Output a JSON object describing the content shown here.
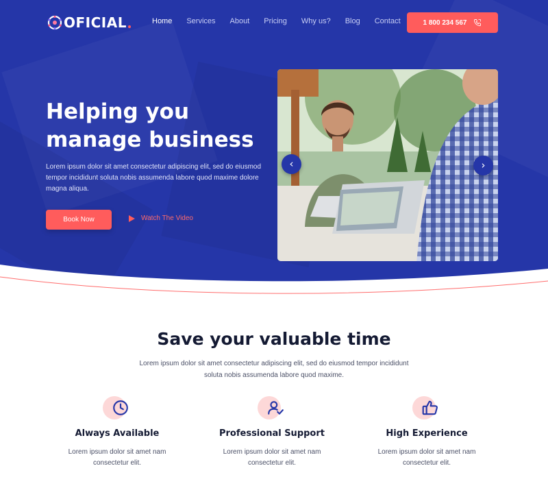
{
  "brand": {
    "logo_text": "OFICIAL"
  },
  "nav": {
    "items": [
      {
        "label": "Home",
        "active": true
      },
      {
        "label": "Services"
      },
      {
        "label": "About"
      },
      {
        "label": "Pricing"
      },
      {
        "label": "Why us?"
      },
      {
        "label": "Blog"
      },
      {
        "label": "Contact"
      }
    ],
    "phone_label": "1 800 234 567",
    "phone_icon": "phone-icon"
  },
  "hero": {
    "title_line1": "Helping you",
    "title_line2": "manage business",
    "description": "Lorem ipsum dolor sit amet consectetur adipiscing elit, sed do eiusmod tempor incididunt soluta nobis assumenda labore quod maxime dolore magna aliqua.",
    "book_label": "Book Now",
    "watch_label": "Watch The Video",
    "slider_prev_icon": "chevron-left-icon",
    "slider_next_icon": "chevron-right-icon"
  },
  "features_section": {
    "title": "Save your valuable time",
    "description": "Lorem ipsum dolor sit amet consectetur adipiscing elit, sed do eiusmod tempor incididunt soluta nobis assumenda labore quod maxime.",
    "items": [
      {
        "icon": "clock-icon",
        "title": "Always Available",
        "desc": "Lorem ipsum dolor sit amet nam consectetur elit."
      },
      {
        "icon": "user-check-icon",
        "title": "Professional Support",
        "desc": "Lorem ipsum dolor sit amet nam consectetur elit."
      },
      {
        "icon": "thumbs-up-icon",
        "title": "High Experience",
        "desc": "Lorem ipsum dolor sit amet nam consectetur elit."
      }
    ]
  },
  "colors": {
    "primary": "#2536a8",
    "accent": "#ff5c5c",
    "icon_bg": "#fdd8d8",
    "heading": "#141a33"
  }
}
